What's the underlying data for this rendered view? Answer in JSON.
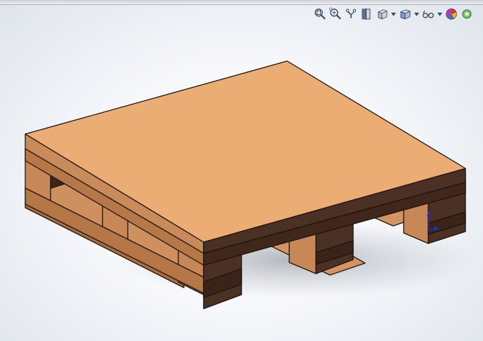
{
  "window": {
    "title": ""
  },
  "toolbar": {
    "items": [
      {
        "name": "zoom-to-fit",
        "icon": "zoom-to-fit-icon"
      },
      {
        "name": "zoom-to-area",
        "icon": "zoom-to-area-icon"
      },
      {
        "name": "previous-view",
        "icon": "previous-view-icon"
      },
      {
        "name": "section-view",
        "icon": "section-view-icon"
      },
      {
        "name": "view-orientation",
        "icon": "view-orientation-icon",
        "dropdown": true
      },
      {
        "name": "display-style",
        "icon": "display-style-icon",
        "dropdown": true
      },
      {
        "name": "hide-show-items",
        "icon": "hide-show-items-icon",
        "dropdown": true
      },
      {
        "name": "edit-appearance",
        "icon": "edit-appearance-icon"
      },
      {
        "name": "apply-scene",
        "icon": "apply-scene-icon"
      }
    ]
  },
  "model": {
    "object": "wooden-pallet",
    "colors": {
      "top": "#ecad74",
      "side_light": "#c9895a",
      "side_dark": "#4b3024",
      "inner_face": "#b97c4e",
      "outline": "#1d140e"
    }
  },
  "triad": {
    "colors": {
      "y_axis": "#1f2fd6",
      "z_axis": "#1f2fd6"
    }
  }
}
